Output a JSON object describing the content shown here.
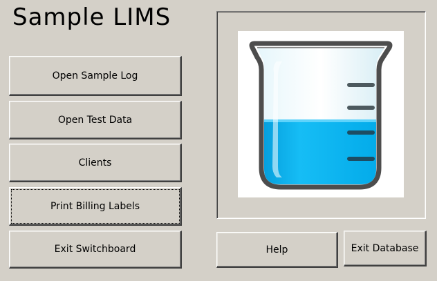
{
  "app": {
    "title": "Sample LIMS"
  },
  "switchboard": {
    "buttons": [
      {
        "label": "Open Sample Log"
      },
      {
        "label": "Open Test Data"
      },
      {
        "label": "Clients"
      },
      {
        "label": "Print Billing Labels"
      },
      {
        "label": "Exit Switchboard"
      }
    ]
  },
  "footer": {
    "help_label": "Help",
    "exit_db_label": "Exit Database"
  },
  "colors": {
    "background": "#d4d0c8",
    "liquid": "#00aeef",
    "glass_outline": "#4d4d4d"
  },
  "icons": {
    "logo": "beaker-icon"
  }
}
